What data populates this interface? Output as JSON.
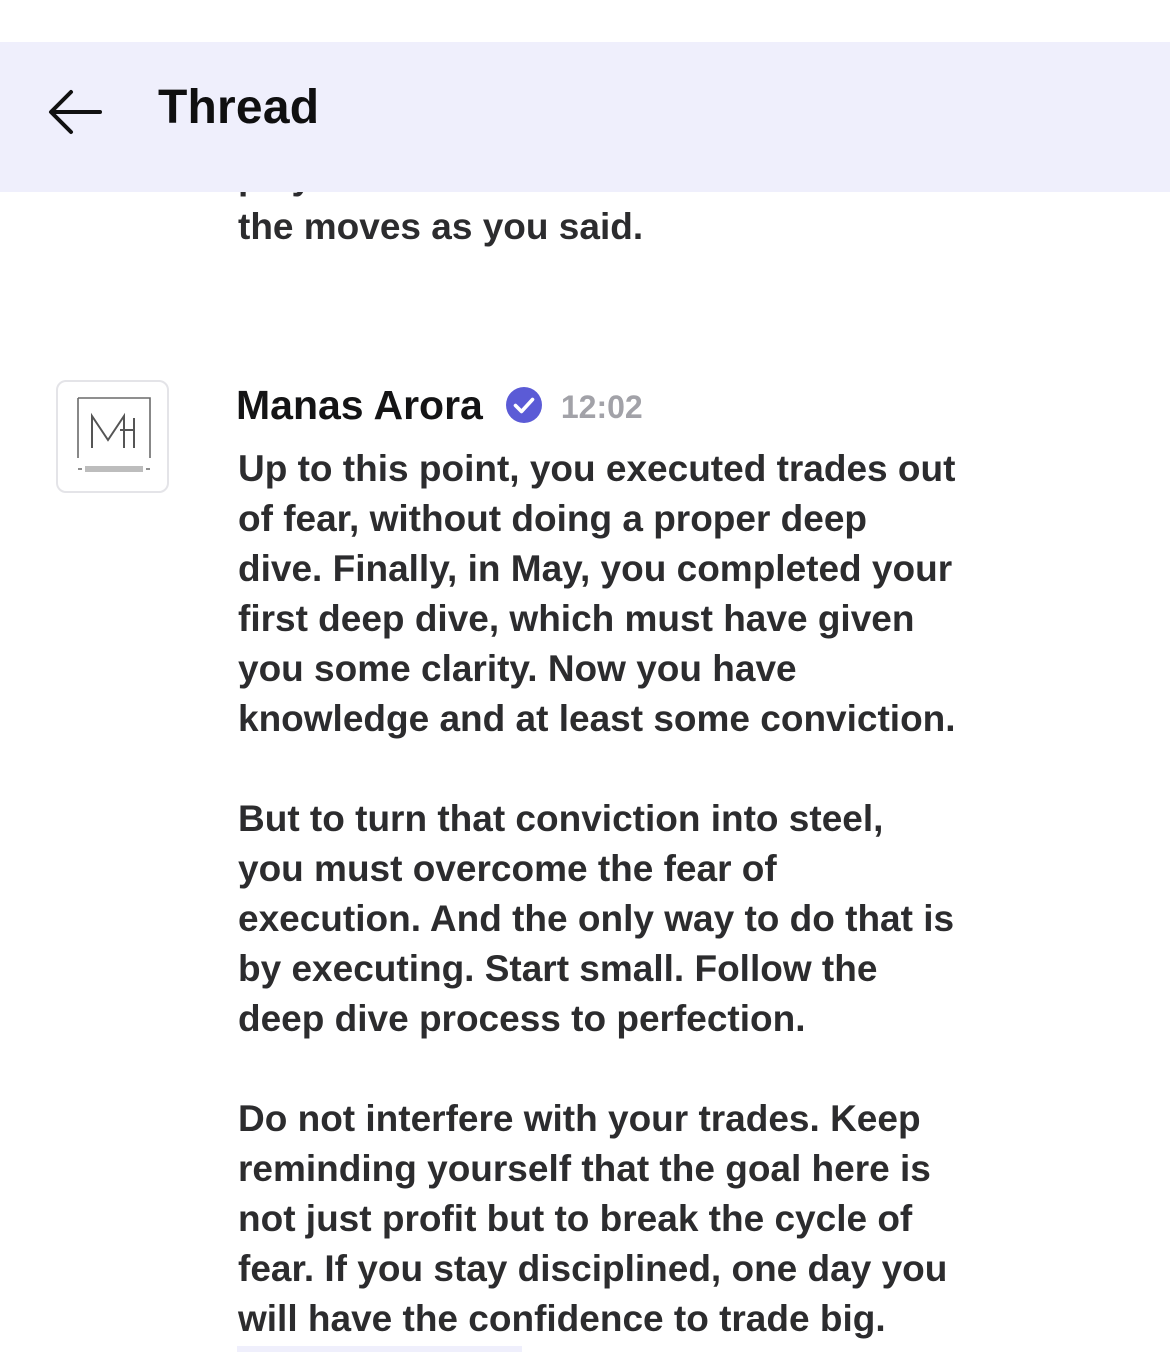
{
  "header": {
    "back_icon": "arrow-left-icon",
    "title": "Thread"
  },
  "previous_message": {
    "lines": [
      "playbook I can revisit all and lookout for",
      "the moves as you said."
    ]
  },
  "message": {
    "avatar_icon": "manas-arora-logo",
    "author": "Manas Arora",
    "verified_icon": "verified-check-icon",
    "verified_color": "#5b5bd6",
    "time": "12:02",
    "paragraphs": [
      {
        "lines": [
          "Up to this point, you executed trades out",
          "of fear, without doing a proper deep",
          "dive. Finally, in May, you completed your",
          "first deep dive, which must have given",
          "you some clarity. Now you have",
          "knowledge and at least some conviction."
        ]
      },
      {
        "lines": [
          "But to turn that conviction into steel,",
          "you must overcome the fear of",
          "execution. And the only way to do that is",
          "by executing. Start small. Follow the",
          "deep dive process to perfection."
        ]
      },
      {
        "lines": [
          "Do not interfere with your trades. Keep",
          "reminding yourself that the goal here is",
          "not just profit but to break the cycle of",
          "fear. If you stay disciplined, one day you",
          "will have the confidence to trade big."
        ]
      }
    ]
  },
  "colors": {
    "header_bg": "#efeffc",
    "text": "#2c2c2e",
    "timestamp": "#a2a2a8"
  }
}
